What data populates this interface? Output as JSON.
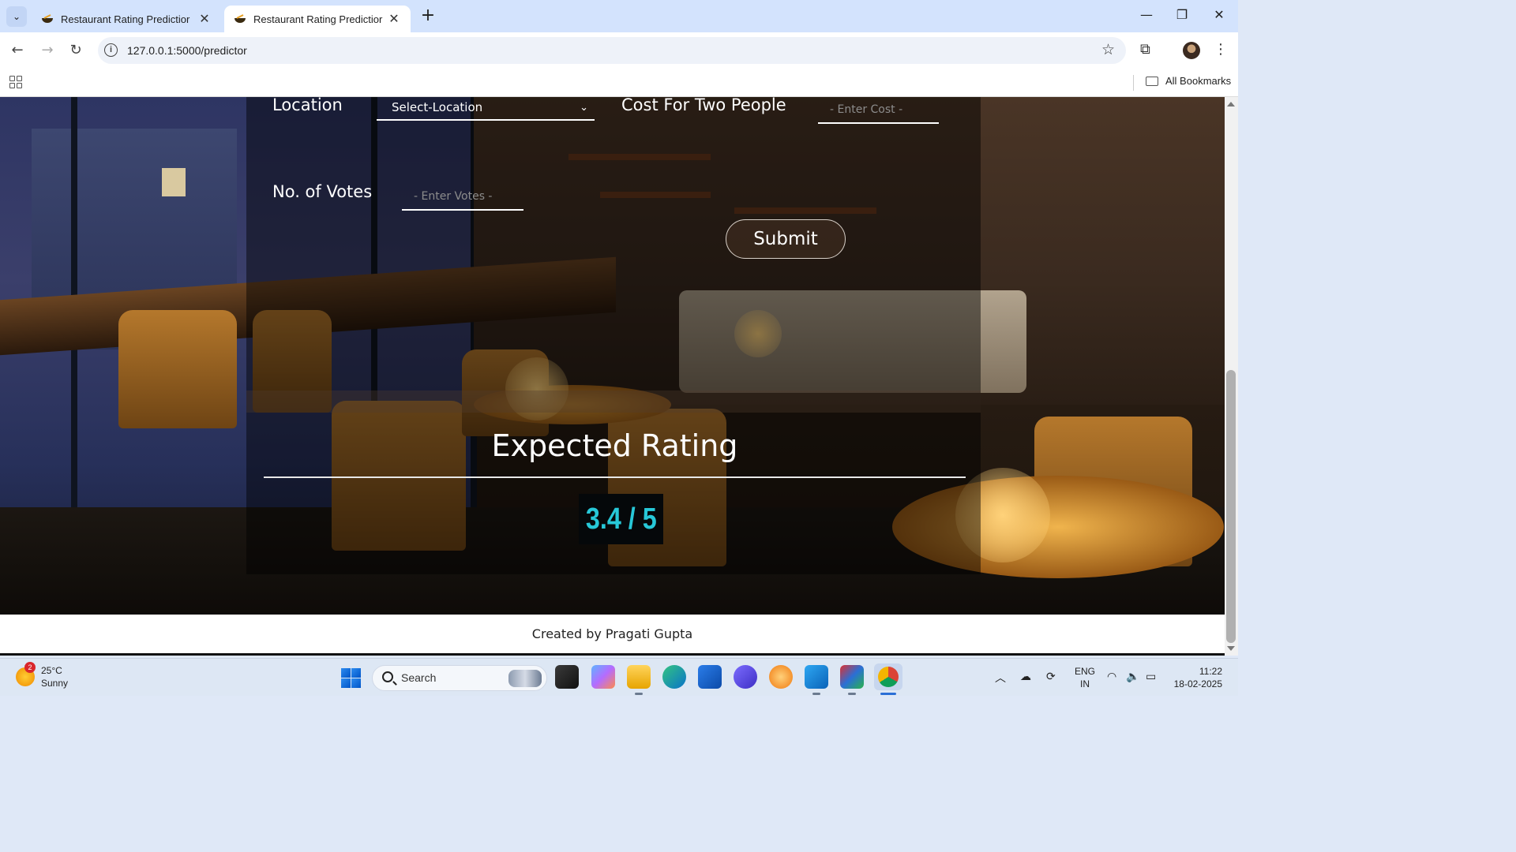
{
  "browser": {
    "tabs": [
      {
        "title": "Restaurant Rating Predictior",
        "active": false
      },
      {
        "title": "Restaurant Rating Predictior",
        "active": true
      }
    ],
    "new_tab_icon": "plus-icon",
    "url": "127.0.0.1:5000/predictor",
    "bookmarks_label": "All Bookmarks"
  },
  "form": {
    "location_label": "Location",
    "location_selected": "Select-Location",
    "cost_label": "Cost For Two People",
    "cost_placeholder": "- Enter Cost -",
    "votes_label": "No. of Votes",
    "votes_placeholder": "- Enter Votes -",
    "submit_label": "Submit"
  },
  "result": {
    "title": "Expected Rating",
    "score": "3.4 / 5",
    "score_color": "#27c8d8"
  },
  "footer": {
    "credit": "Created by Pragati Gupta"
  },
  "taskbar": {
    "weather_badge": "2",
    "temperature": "25°C",
    "condition": "Sunny",
    "search_label": "Search",
    "lang_line1": "ENG",
    "lang_line2": "IN",
    "time": "11:22",
    "date": "18-02-2025"
  }
}
